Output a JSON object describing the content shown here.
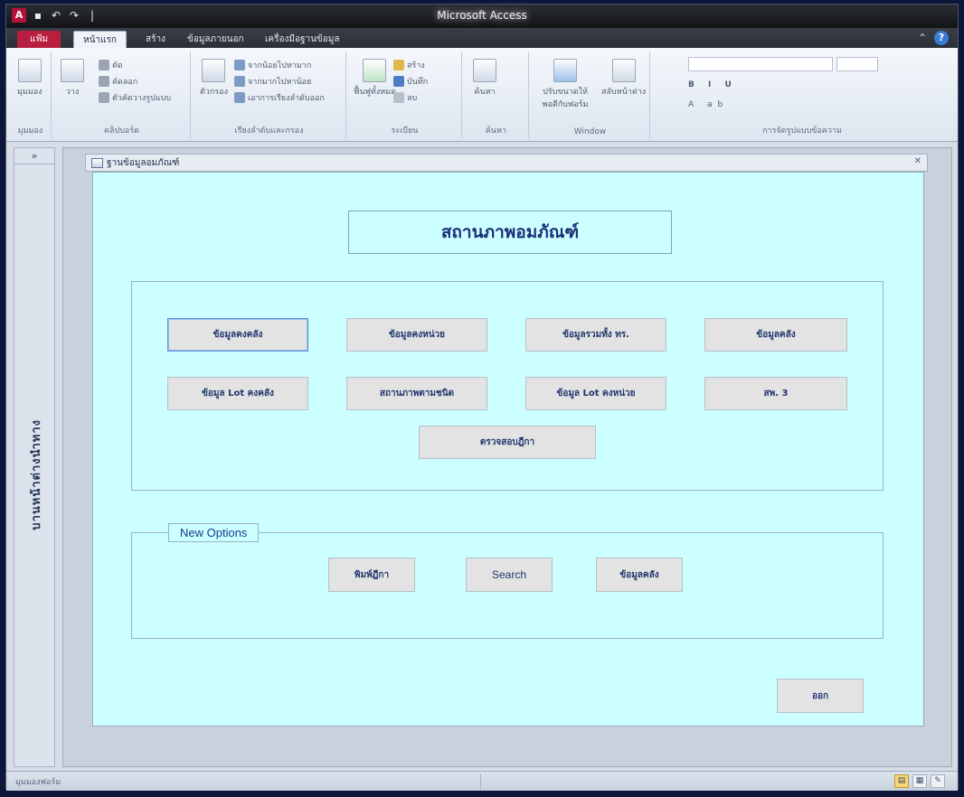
{
  "window": {
    "title": "Microsoft Access"
  },
  "tabs": [
    {
      "label": "แฟ้ม"
    },
    {
      "label": "หน้าแรก"
    },
    {
      "label": "สร้าง"
    },
    {
      "label": "ข้อมูลภายนอก"
    },
    {
      "label": "เครื่องมือฐานข้อมูล"
    }
  ],
  "ribbon": {
    "groups": [
      {
        "label": "มุมมอง",
        "buttons": [
          "มุมมอง"
        ]
      },
      {
        "label": "คลิปบอร์ด",
        "buttons": [
          "ตัด",
          "คัดลอก",
          "ตัวคัดวางรูปแบบ",
          "วาง"
        ]
      },
      {
        "label": "เรียงลำดับและกรอง",
        "buttons": [
          "จากน้อยไปหามาก",
          "จากมากไปหาน้อย",
          "เอาการเรียงลำดับออก",
          "ตัวกรอง"
        ]
      },
      {
        "label": "ระเบียน",
        "buttons": [
          "สร้าง",
          "บันทึก",
          "ลบ",
          "ฟื้นฟูทั้งหมด"
        ]
      },
      {
        "label": "ค้นหา",
        "buttons": [
          "ค้นหา"
        ]
      },
      {
        "label": "Window",
        "buttons": [
          "ปรับขนาดให้พอดีกับฟอร์ม",
          "สลับหน้าต่าง"
        ]
      },
      {
        "label": "การจัดรูปแบบข้อความ",
        "buttons": []
      }
    ]
  },
  "nav_pane": {
    "label": "บานหน้าต่างนำทาง",
    "toggle": "»"
  },
  "document": {
    "tab_title": "ฐานข้อมูลอมภัณฑ์",
    "form_title": "สถานภาพอมภัณฑ์",
    "main_buttons": [
      "ข้อมูลคงคลัง",
      "ข้อมูลคงหน่วย",
      "ข้อมูลรวมทั้ง ทร.",
      "ข้อมูลคลัง",
      "ข้อมูล Lot คงคลัง",
      "สถานภาพตามชนิด",
      "ข้อมูล Lot คงหน่วย",
      "สพ. 3",
      "ตรวจสอบฎีกา"
    ],
    "new_options": {
      "legend": "New Options",
      "buttons": [
        "พิมพ์ฎีกา",
        "Search",
        "ข้อมูลคลัง"
      ]
    },
    "exit_button": "ออก"
  },
  "status": {
    "text": "มุมมองฟอร์ม"
  }
}
